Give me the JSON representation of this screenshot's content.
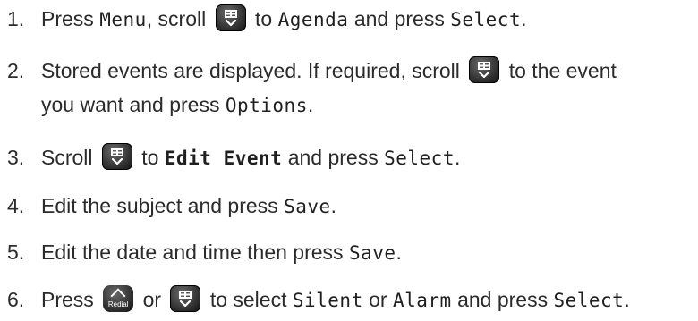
{
  "icons": {
    "scroll_key": "scroll-key-icon",
    "redial_key": "redial-up-key-icon"
  },
  "steps": [
    {
      "number": "1.",
      "t1": "Press",
      "menu": "Menu",
      "t2": ", scroll",
      "t3": "to",
      "agenda": "Agenda",
      "t4": "and press",
      "select": "Select",
      "t5": "."
    },
    {
      "number": "2.",
      "t1": "Stored events are displayed. If required, scroll",
      "t2": "to the event",
      "t3": "you want and press",
      "options": "Options",
      "t4": "."
    },
    {
      "number": "3.",
      "t1": "Scroll",
      "t2": "to",
      "edit_event": "Edit Event",
      "t3": "and press",
      "select": "Select",
      "t4": "."
    },
    {
      "number": "4.",
      "t1": "Edit the subject and press",
      "save": "Save",
      "t2": "."
    },
    {
      "number": "5.",
      "t1": "Edit the date and time then press",
      "save": "Save",
      "t2": "."
    },
    {
      "number": "6.",
      "t1": "Press",
      "redial_label": "Redial",
      "t2": "or",
      "t3": "to select",
      "silent": "Silent",
      "t4": "or",
      "alarm": "Alarm",
      "t5": "and press",
      "select": "Select",
      "t6": "."
    }
  ]
}
